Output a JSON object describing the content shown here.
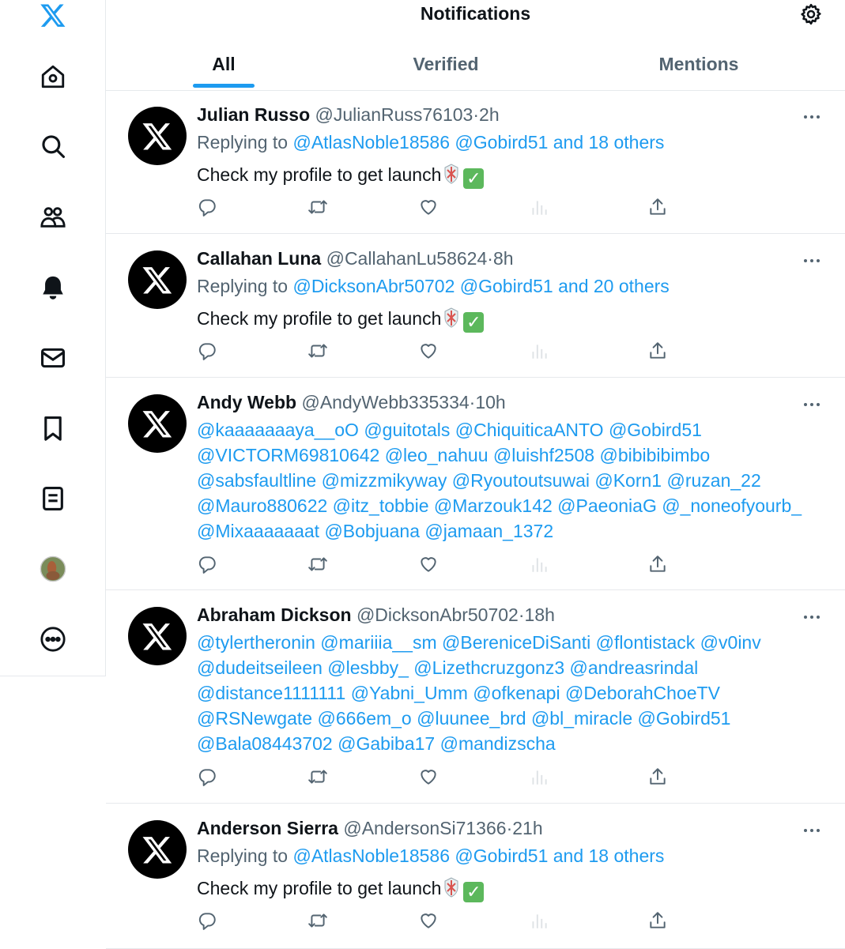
{
  "icons": {
    "logo": "x-logo-icon",
    "nav": [
      "home-icon",
      "search-icon",
      "communities-icon",
      "notifications-bell-icon",
      "messages-icon",
      "bookmarks-icon",
      "lists-icon",
      "profile-avatar",
      "more-icon"
    ]
  },
  "colors": {
    "accent": "#1d9bf0",
    "text": "#0f1419",
    "secondary": "#536471",
    "border": "#e6e9ec"
  },
  "header": {
    "title": "Notifications",
    "tabs": [
      {
        "label": "All",
        "active": true
      },
      {
        "label": "Verified",
        "active": false
      },
      {
        "label": "Mentions",
        "active": false
      }
    ]
  },
  "tweets": [
    {
      "name": "Julian Russo",
      "handle": "@JulianRuss76103",
      "sep": "·",
      "time": "2h",
      "reply_prefix": "Replying to",
      "reply_targets": "@AtlasNoble18586 @Gobird51 and 18 others",
      "text": "Check my profile to get launch",
      "check": "✓"
    },
    {
      "name": "Callahan Luna",
      "handle": "@CallahanLu58624",
      "sep": "·",
      "time": "8h",
      "reply_prefix": "Replying to",
      "reply_targets": "@DicksonAbr50702 @Gobird51 and 20 others",
      "text": "Check my profile to get launch",
      "check": "✓"
    },
    {
      "name": "Andy Webb",
      "handle": "@AndyWebb335334",
      "sep": "·",
      "time": "10h",
      "mentions": [
        "@kaaaaaaaya__oO @guitotals @ChiquiticaANTO @Gobird51",
        "@VICTORM69810642 @leo_nahuu @luishf2508 @bibibibimbo",
        "@sabsfaultline @mizzmikyway @Ryoutoutsuwai @Korn1 @ruzan_22",
        "@Mauro880622 @itz_tobbie @Marzouk142 @PaeoniaG @_noneofyourb_",
        "@Mixaaaaaaat @Bobjuana @jamaan_1372"
      ]
    },
    {
      "name": "Abraham Dickson",
      "handle": "@DicksonAbr50702",
      "sep": "·",
      "time": "18h",
      "mentions": [
        "@tylertheronin @mariiia__sm @BereniceDiSanti @flontistack @v0inv",
        "@dudeitseileen @lesbby_ @Lizethcruzgonz3 @andreasrindal",
        "@distance1111111 @Yabni_Umm @ofkenapi @DeborahChoeTV",
        "@RSNewgate @666em_o @luunee_brd @bl_miracle @Gobird51",
        "@Bala08443702 @Gabiba17 @mandizscha"
      ]
    },
    {
      "name": "Anderson Sierra",
      "handle": "@AndersonSi71366",
      "sep": "·",
      "time": "21h",
      "reply_prefix": "Replying to",
      "reply_targets": "@AtlasNoble18586 @Gobird51 and 18 others",
      "text": "Check my profile to get launch",
      "check": "✓"
    }
  ],
  "action_icons": [
    "reply-icon",
    "retweet-icon",
    "like-icon",
    "views-icon",
    "share-icon"
  ]
}
